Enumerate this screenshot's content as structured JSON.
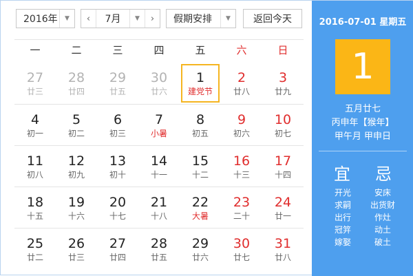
{
  "toolbar": {
    "year": "2016年",
    "month": "7月",
    "holiday": "假期安排",
    "today": "返回今天"
  },
  "weekdays": [
    "一",
    "二",
    "三",
    "四",
    "五",
    "六",
    "日"
  ],
  "weeks": [
    [
      {
        "day": "27",
        "lunar": "廿三",
        "other": true
      },
      {
        "day": "28",
        "lunar": "廿四",
        "other": true
      },
      {
        "day": "29",
        "lunar": "廿五",
        "other": true
      },
      {
        "day": "30",
        "lunar": "廿六",
        "other": true
      },
      {
        "day": "1",
        "lunar": "建党节",
        "festival": true,
        "selected": true
      },
      {
        "day": "2",
        "lunar": "廿八",
        "weekend": true
      },
      {
        "day": "3",
        "lunar": "廿九",
        "weekend": true
      }
    ],
    [
      {
        "day": "4",
        "lunar": "初一"
      },
      {
        "day": "5",
        "lunar": "初二"
      },
      {
        "day": "6",
        "lunar": "初三"
      },
      {
        "day": "7",
        "lunar": "小暑",
        "festival": true
      },
      {
        "day": "8",
        "lunar": "初五"
      },
      {
        "day": "9",
        "lunar": "初六",
        "weekend": true
      },
      {
        "day": "10",
        "lunar": "初七",
        "weekend": true
      }
    ],
    [
      {
        "day": "11",
        "lunar": "初八"
      },
      {
        "day": "12",
        "lunar": "初九"
      },
      {
        "day": "13",
        "lunar": "初十"
      },
      {
        "day": "14",
        "lunar": "十一"
      },
      {
        "day": "15",
        "lunar": "十二"
      },
      {
        "day": "16",
        "lunar": "十三",
        "weekend": true
      },
      {
        "day": "17",
        "lunar": "十四",
        "weekend": true
      }
    ],
    [
      {
        "day": "18",
        "lunar": "十五"
      },
      {
        "day": "19",
        "lunar": "十六"
      },
      {
        "day": "20",
        "lunar": "十七"
      },
      {
        "day": "21",
        "lunar": "十八"
      },
      {
        "day": "22",
        "lunar": "大暑",
        "festival": true
      },
      {
        "day": "23",
        "lunar": "二十",
        "weekend": true
      },
      {
        "day": "24",
        "lunar": "廿一",
        "weekend": true
      }
    ],
    [
      {
        "day": "25",
        "lunar": "廿二"
      },
      {
        "day": "26",
        "lunar": "廿三"
      },
      {
        "day": "27",
        "lunar": "廿四"
      },
      {
        "day": "28",
        "lunar": "廿五"
      },
      {
        "day": "29",
        "lunar": "廿六"
      },
      {
        "day": "30",
        "lunar": "廿七",
        "weekend": true
      },
      {
        "day": "31",
        "lunar": "廿八",
        "weekend": true
      }
    ]
  ],
  "side": {
    "date_line": "2016-07-01 星期五",
    "big_day": "1",
    "lunar_date": "五月廿七",
    "year_gz": "丙申年【猴年】",
    "month_day_gz": "甲午月 甲申日",
    "yi_label": "宜",
    "ji_label": "忌",
    "yi_items": [
      "开光",
      "求嗣",
      "出行",
      "冠笄",
      "嫁娶"
    ],
    "ji_items": [
      "安床",
      "出货财",
      "作灶",
      "动土",
      "破土"
    ]
  },
  "colors": {
    "accent_blue": "#4e9fee",
    "today_orange": "#fbb616",
    "weekend_red": "#e02d2d",
    "selected_border": "#f5b520"
  }
}
